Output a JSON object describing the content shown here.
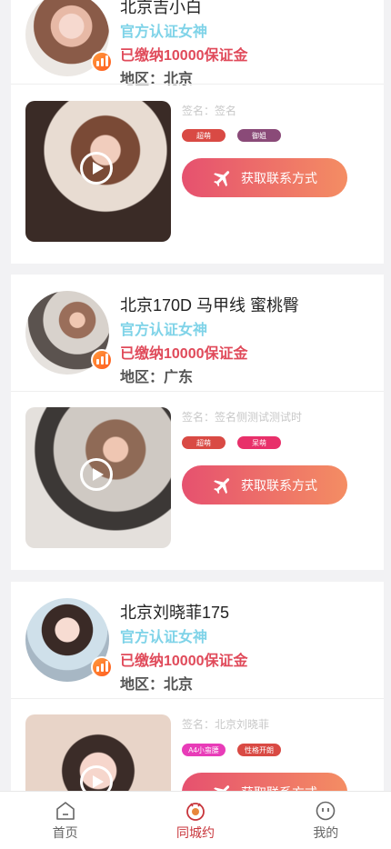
{
  "profiles": [
    {
      "name": "北京吉小白",
      "verified": "官方认证女神",
      "deposit": "已缴纳10000保证金",
      "region": "地区：北京",
      "signature": "签名：签名",
      "tags": [
        {
          "label": "超萌",
          "color": "#d94a44"
        },
        {
          "label": "御姐",
          "color": "#8a4a78"
        }
      ],
      "contact_label": "获取联系方式"
    },
    {
      "name": "北京170D 马甲线 蜜桃臀",
      "verified": "官方认证女神",
      "deposit": "已缴纳10000保证金",
      "region": "地区：广东",
      "signature": "签名：签名侧测试测试时",
      "tags": [
        {
          "label": "超萌",
          "color": "#d94a44"
        },
        {
          "label": "呆萌",
          "color": "#e8306a"
        }
      ],
      "contact_label": "获取联系方式"
    },
    {
      "name": "北京刘晓菲175",
      "verified": "官方认证女神",
      "deposit": "已缴纳10000保证金",
      "region": "地区：北京",
      "signature": "签名：北京刘晓菲",
      "tags": [
        {
          "label": "A4小蛮腰",
          "color": "#e83cb8"
        },
        {
          "label": "性格开朗",
          "color": "#d94a44"
        }
      ],
      "contact_label": "获取联系方式"
    }
  ],
  "tabbar": {
    "home": "首页",
    "city_date": "同城约",
    "mine": "我的",
    "active_color": "#c8363c",
    "inactive_color": "#666666"
  }
}
